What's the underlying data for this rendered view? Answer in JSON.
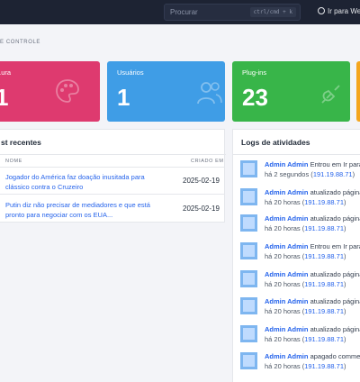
{
  "topbar": {
    "search_placeholder": "Procurar",
    "search_shortcut": "ctrl/cmd + k",
    "visit_label": "Ir para Web"
  },
  "breadcrumb": "E CONTROLE",
  "cards": [
    {
      "label": "...ura",
      "count": "1",
      "color": "#de3a6f",
      "icon": "palette-icon"
    },
    {
      "label": "Usuários",
      "count": "1",
      "color": "#3f9de6",
      "icon": "users-icon"
    },
    {
      "label": "Plug-ins",
      "count": "23",
      "color": "#38b549",
      "icon": "plug-icon"
    }
  ],
  "posts": {
    "title": "st recentes",
    "col_name": "NOME",
    "col_created": "CRIADO EM",
    "rows": [
      {
        "title": "Jogador do América faz doação inusitada para clássico contra o Cruzeiro",
        "date": "2025-02-19"
      },
      {
        "title": "Putin diz não precisar de mediadores e que está pronto para negociar com os EUA...",
        "date": "2025-02-19"
      }
    ]
  },
  "logs": {
    "title": "Logs de atividades",
    "items": [
      {
        "user": "Admin Admin",
        "action": "Entrou em Ir para site",
        "time": "há 2 segundos",
        "ip": "191.19.88.71"
      },
      {
        "user": "Admin Admin",
        "action": "atualizado página \"V",
        "time": "há 20 horas",
        "ip": "191.19.88.71"
      },
      {
        "user": "Admin Admin",
        "action": "atualizado página \"V",
        "time": "há 20 horas",
        "ip": "191.19.88.71"
      },
      {
        "user": "Admin Admin",
        "action": "Entrou em Ir para site",
        "time": "há 20 horas",
        "ip": "191.19.88.71"
      },
      {
        "user": "Admin Admin",
        "action": "atualizado página \"V",
        "time": "há 20 horas",
        "ip": "191.19.88.71"
      },
      {
        "user": "Admin Admin",
        "action": "atualizado página \"V",
        "time": "há 20 horas",
        "ip": "191.19.88.71"
      },
      {
        "user": "Admin Admin",
        "action": "atualizado página \"V",
        "time": "há 20 horas",
        "ip": "191.19.88.71"
      },
      {
        "user": "Admin Admin",
        "action": "apagado comment",
        "time": "há 20 horas",
        "ip": "191.19.88.71"
      }
    ]
  }
}
